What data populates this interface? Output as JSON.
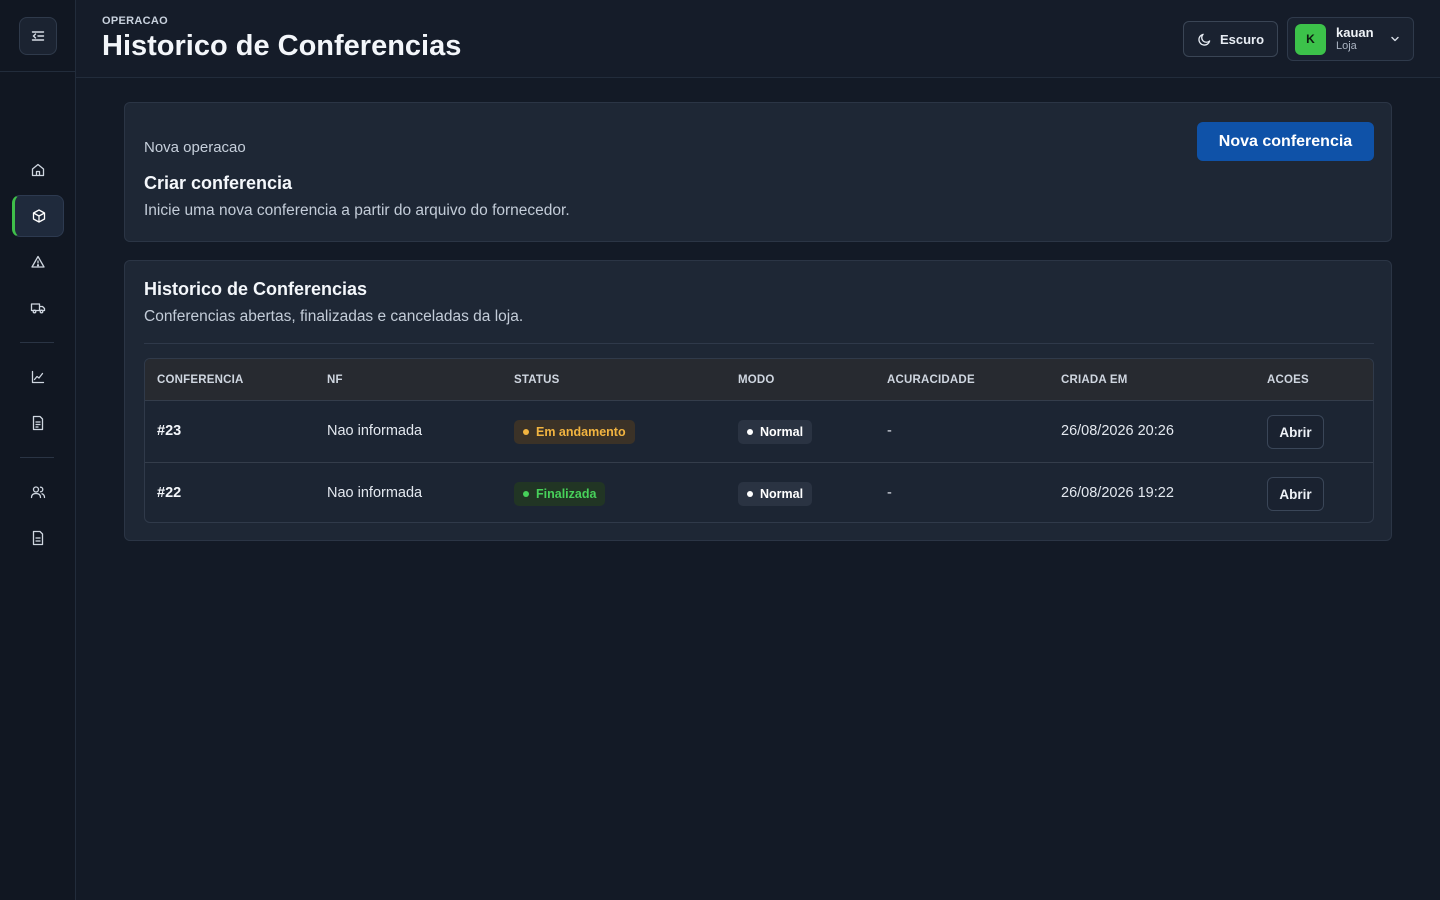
{
  "header": {
    "eyebrow": "OPERACAO",
    "title": "Historico de Conferencias",
    "theme_label": "Escuro",
    "user": {
      "initial": "K",
      "name": "kauan",
      "role": "Loja"
    }
  },
  "sidebar": {
    "items": [
      {
        "icon": "home-icon"
      },
      {
        "icon": "box-icon",
        "active": true
      },
      {
        "icon": "warning-icon"
      },
      {
        "icon": "truck-icon"
      },
      {
        "icon": "chart-icon"
      },
      {
        "icon": "document-icon"
      },
      {
        "icon": "users-icon"
      },
      {
        "icon": "file-icon"
      }
    ]
  },
  "create_card": {
    "eyebrow": "Nova operacao",
    "title": "Criar conferencia",
    "description": "Inicie uma nova conferencia a partir do arquivo do fornecedor.",
    "button_label": "Nova conferencia"
  },
  "history_card": {
    "title": "Historico de Conferencias",
    "description": "Conferencias abertas, finalizadas e canceladas da loja.",
    "columns": [
      "CONFERENCIA",
      "NF",
      "STATUS",
      "MODO",
      "ACURACIDADE",
      "CRIADA EM",
      "ACOES"
    ],
    "rows": [
      {
        "id": "#23",
        "nf": "Nao informada",
        "status": "Em andamento",
        "mode": "Normal",
        "accuracy": "-",
        "created": "26/08/2026 20:26",
        "action": "Abrir"
      },
      {
        "id": "#22",
        "nf": "Nao informada",
        "status": "Finalizada",
        "mode": "Normal",
        "accuracy": "-",
        "created": "26/08/2026 19:22",
        "action": "Abrir"
      }
    ]
  },
  "colors": {
    "accent_green": "#3cc24a",
    "primary_blue": "#0f52a8",
    "status_in_progress": "#f2b440",
    "status_done": "#47d15a"
  }
}
